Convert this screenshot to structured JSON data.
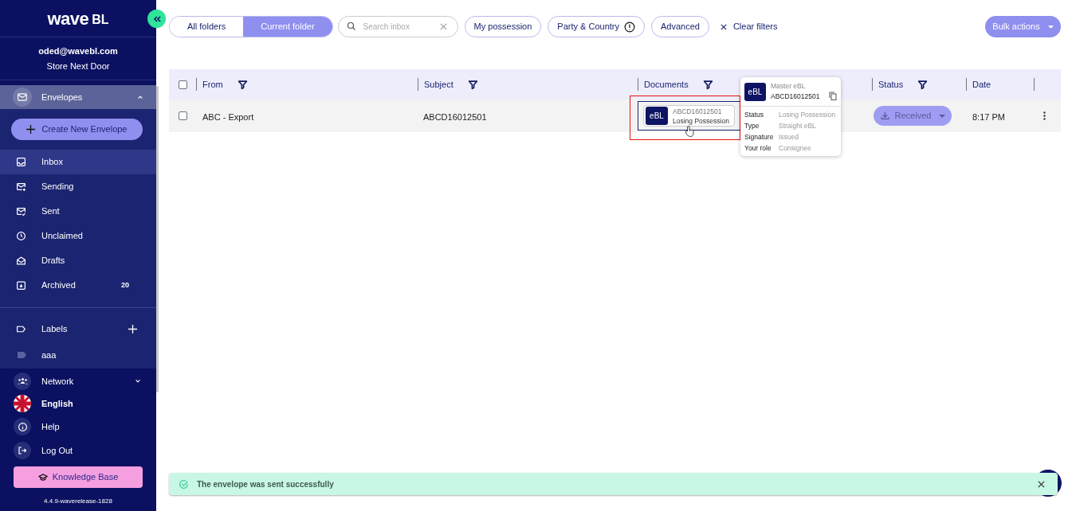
{
  "sidebar": {
    "logo_word": "wave",
    "logo_suffix": "BL",
    "email": "oded@wavebl.com",
    "company": "Store Next Door",
    "envelopes": {
      "label": "Envelopes",
      "expanded": true
    },
    "create_button": "Create New Envelope",
    "folders": [
      {
        "label": "Inbox",
        "selected": true
      },
      {
        "label": "Sending",
        "selected": false
      },
      {
        "label": "Sent",
        "selected": false
      },
      {
        "label": "Unclaimed",
        "selected": false
      },
      {
        "label": "Drafts",
        "selected": false
      },
      {
        "label": "Archived",
        "selected": false,
        "count": "20"
      }
    ],
    "labels": {
      "title": "Labels",
      "items": [
        {
          "label": "aaa"
        }
      ]
    },
    "network": {
      "label": "Network",
      "expanded": false
    },
    "language": "English",
    "help": "Help",
    "logout": "Log Out",
    "knowledge_base": "Knowledge Base",
    "version": "4.4.9-waverelease-1828"
  },
  "toolbar": {
    "scope": [
      {
        "label": "All folders",
        "selected": false
      },
      {
        "label": "Current folder",
        "selected": true
      }
    ],
    "search": {
      "placeholder": "Search inbox"
    },
    "filters": [
      {
        "label": "My possession",
        "alert": false
      },
      {
        "label": "Party & Country",
        "alert": true
      },
      {
        "label": "Advanced",
        "alert": false
      }
    ],
    "clear_filters": "Clear filters",
    "bulk_actions": "Bulk actions"
  },
  "table": {
    "select_all": {
      "checked": false
    },
    "columns": [
      {
        "label": "From",
        "filterable": true
      },
      {
        "label": "Subject",
        "filterable": true
      },
      {
        "label": "Documents",
        "filterable": true
      },
      {
        "label": "Status",
        "filterable": true
      },
      {
        "label": "Date",
        "filterable": false
      }
    ],
    "rows": [
      {
        "checked": false,
        "from": "ABC - Export",
        "subject": "ABCD16012501",
        "document": {
          "badge": "eBL",
          "number": "ABCD16012501",
          "status": "Losing Possession"
        },
        "status": "Received",
        "date": "8:17 PM"
      }
    ]
  },
  "tooltip": {
    "badge": "eBL",
    "title": "Master eBL",
    "number": "ABCD16012501",
    "fields": [
      {
        "label": "Status",
        "value": "Losing Possession"
      },
      {
        "label": "Type",
        "value": "Straight eBL"
      },
      {
        "label": "Signature",
        "value": "Issued"
      },
      {
        "label": "Your role",
        "value": "Consignee"
      }
    ]
  },
  "toast": {
    "message": "The envelope was sent successfully"
  }
}
